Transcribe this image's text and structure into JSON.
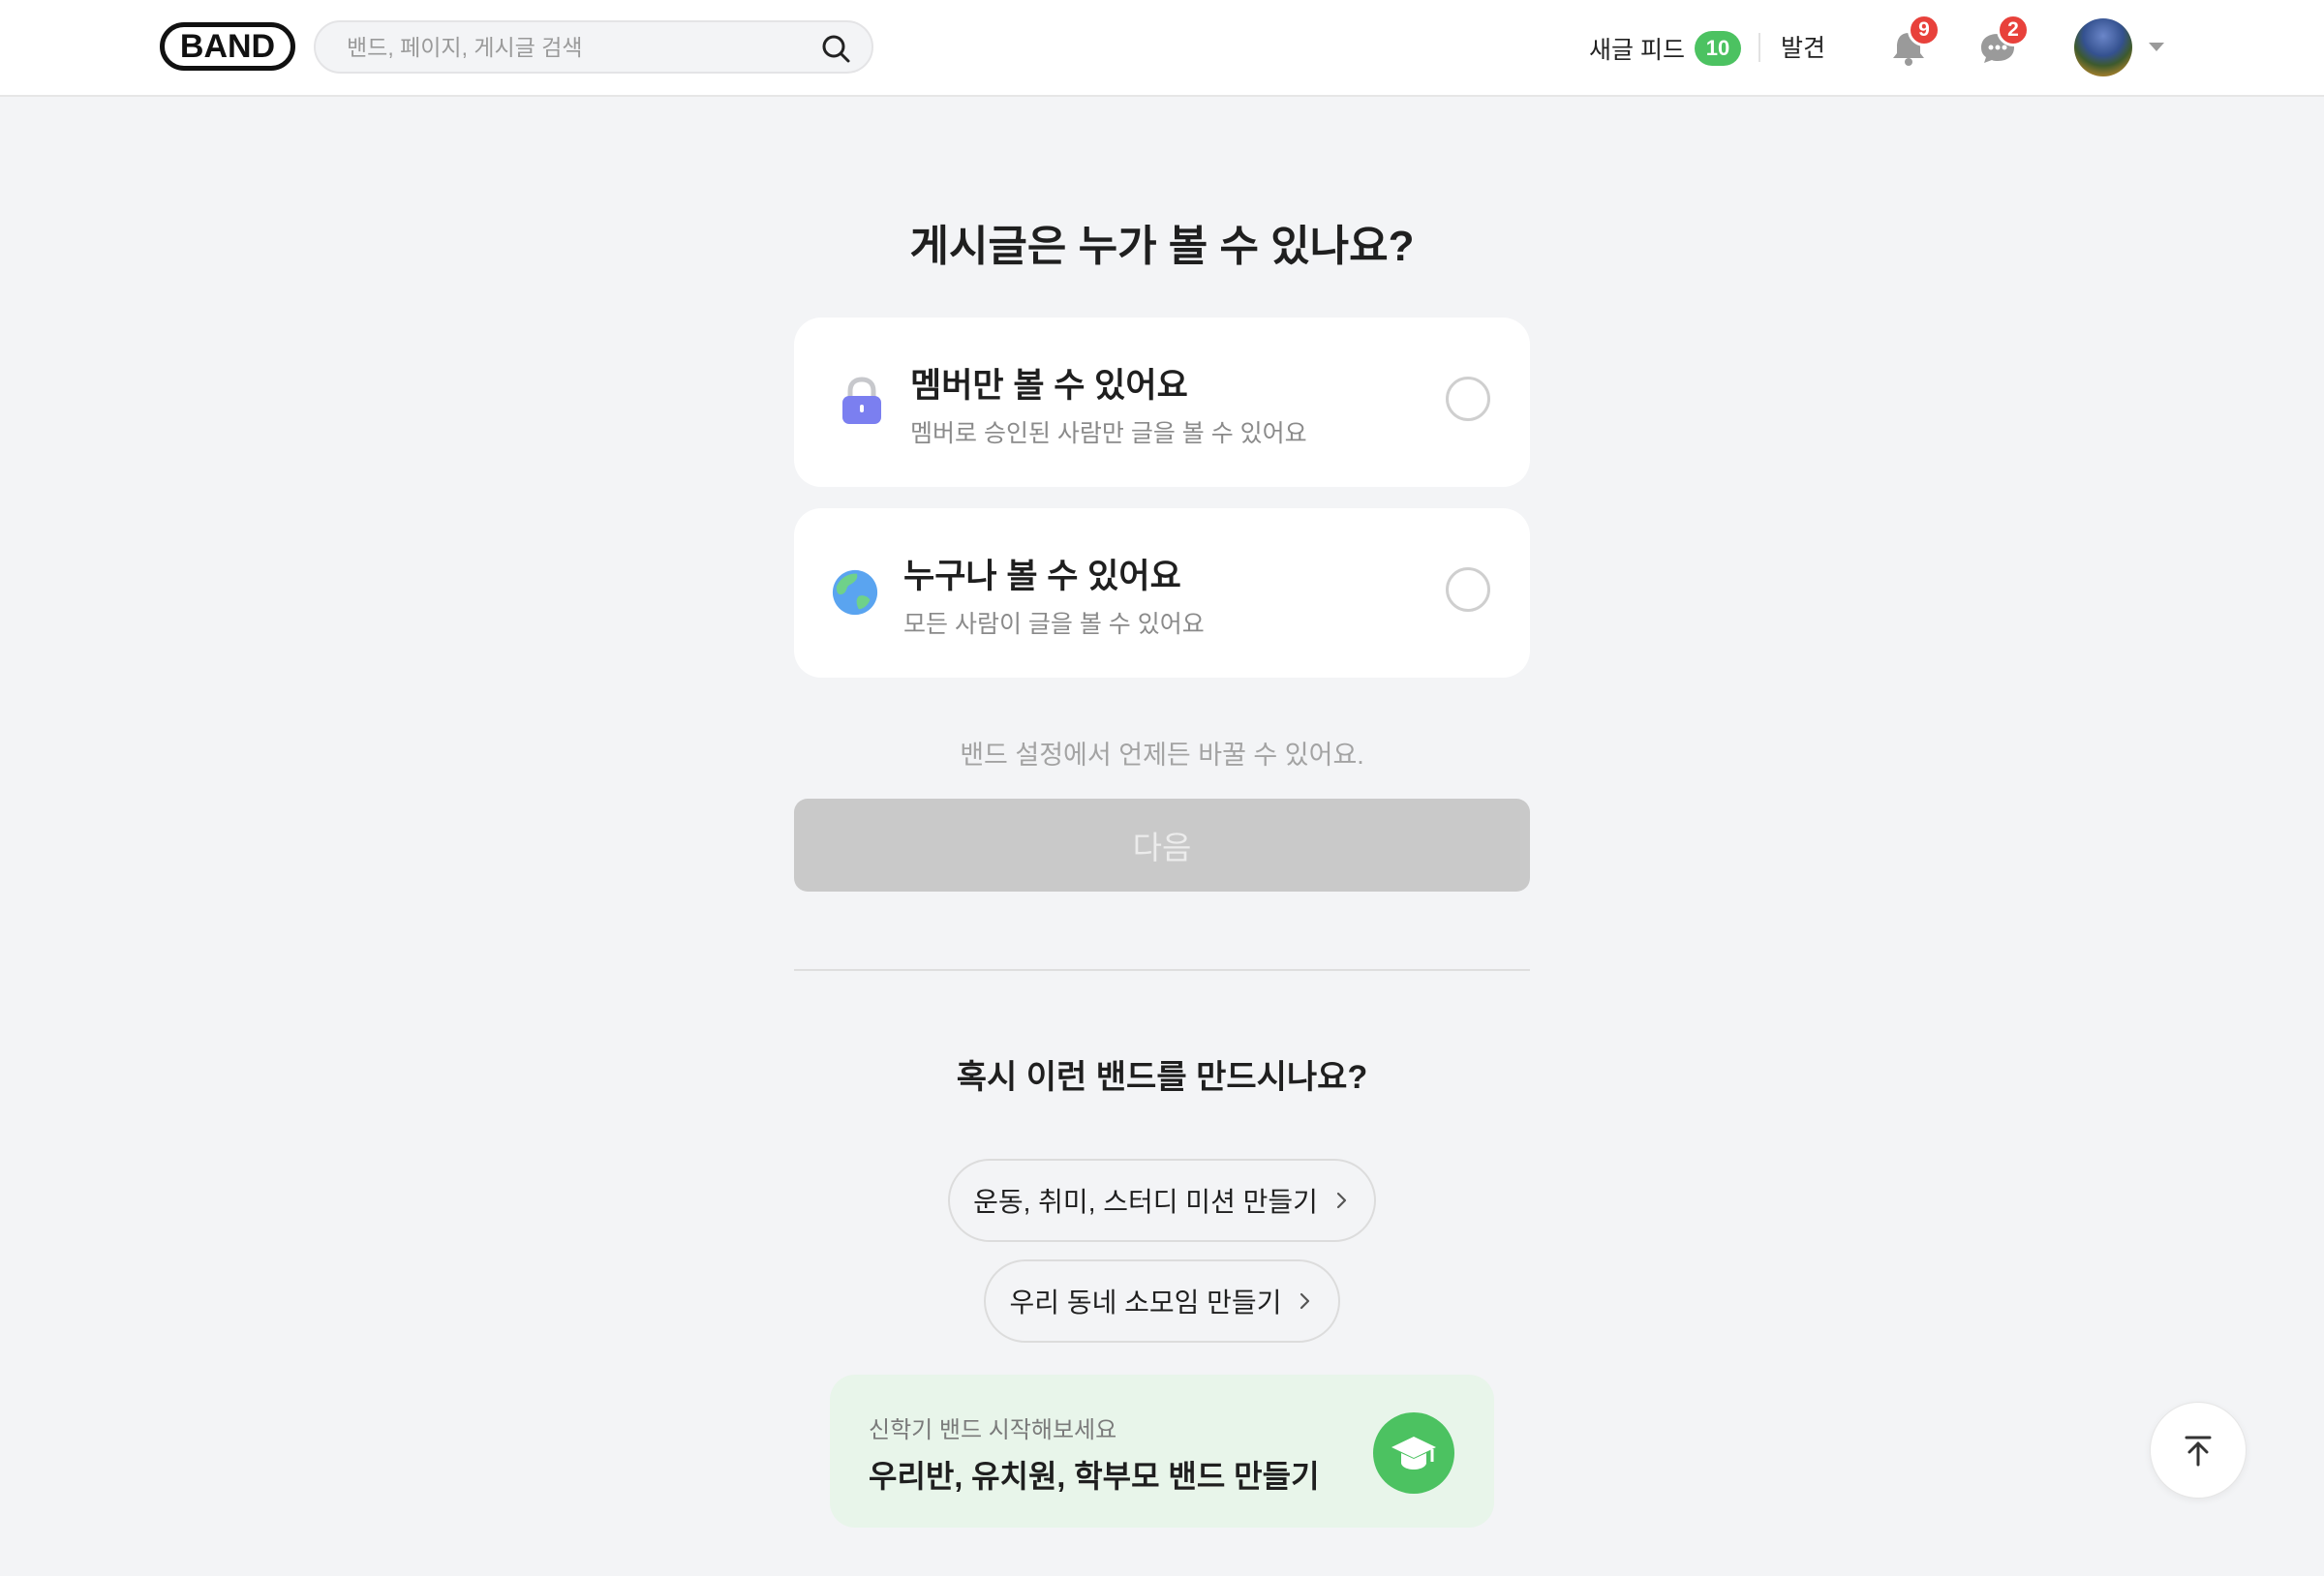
{
  "header": {
    "logo": "BAND",
    "search_placeholder": "밴드, 페이지, 게시글 검색",
    "feed_label": "새글 피드",
    "feed_count": "10",
    "discover_label": "발견",
    "notifications_count": "9",
    "chats_count": "2"
  },
  "main": {
    "title": "게시글은 누가 볼 수 있나요?",
    "options": [
      {
        "title": "멤버만 볼 수 있어요",
        "desc": "멤버로 승인된 사람만 글을 볼 수 있어요",
        "icon": "lock-icon",
        "selected": false
      },
      {
        "title": "누구나 볼 수 있어요",
        "desc": "모든 사람이 글을 볼 수 있어요",
        "icon": "globe-icon",
        "selected": false
      }
    ],
    "hint": "밴드 설정에서 언제든 바꿀 수 있어요.",
    "next_label": "다음"
  },
  "suggest": {
    "title": "혹시 이런 밴드를 만드시나요?",
    "pills": [
      {
        "label": "운동, 취미, 스터디 미션 만들기"
      },
      {
        "label": "우리 동네 소모임 만들기"
      }
    ],
    "promo": {
      "sub": "신학기 밴드 시작해보세요",
      "title": "우리반, 유치원, 학부모 밴드 만들기"
    }
  },
  "colors": {
    "accent_green": "#4cc261",
    "badge_red": "#e8413b",
    "lock_purple": "#7b7ff0",
    "disabled_button": "#c9c9c9"
  }
}
